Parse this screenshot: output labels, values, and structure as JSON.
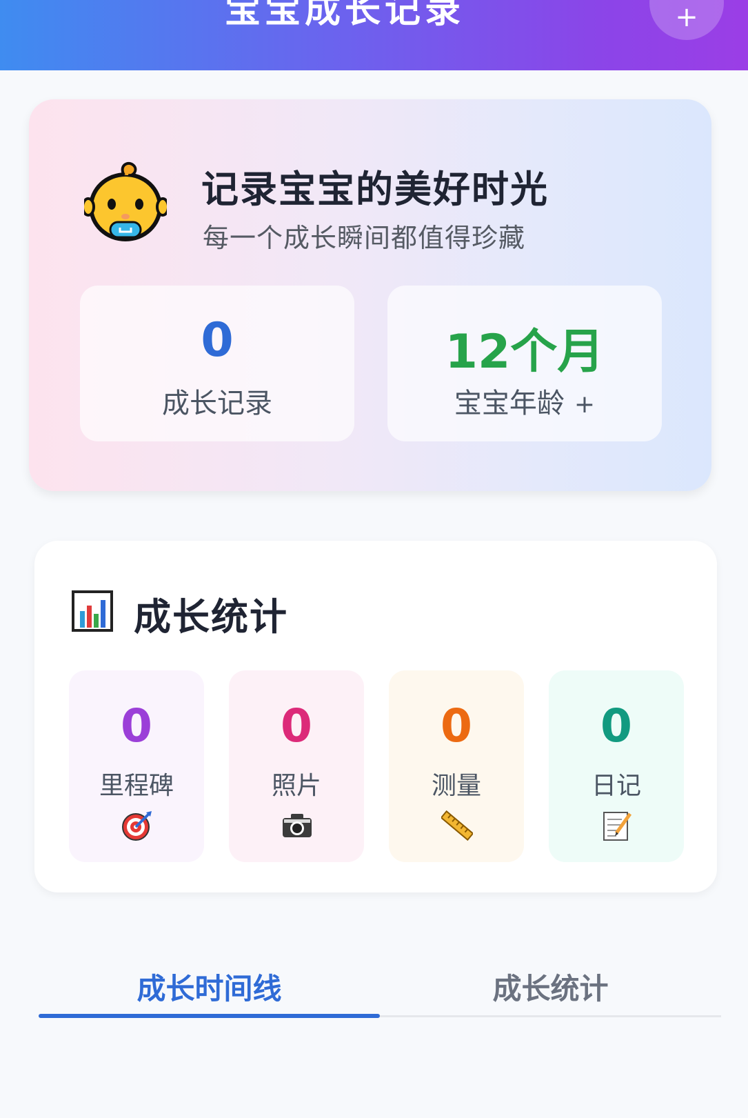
{
  "header": {
    "title": "宝宝成长记录",
    "add_label": "+"
  },
  "hero": {
    "title": "记录宝宝的美好时光",
    "subtitle": "每一个成长瞬间都值得珍藏",
    "icon": "baby-face-icon",
    "cards": [
      {
        "value": "0",
        "label": "成长记录",
        "color": "#2f6bd6"
      },
      {
        "value": "12个月",
        "label": "宝宝年龄",
        "action": "+",
        "color": "#27a34a"
      }
    ]
  },
  "stats": {
    "title": "成长统计",
    "icon": "bar-chart-icon",
    "items": [
      {
        "value": "0",
        "label": "里程碑",
        "icon": "target-icon",
        "color": "#9b3fd8"
      },
      {
        "value": "0",
        "label": "照片",
        "icon": "camera-icon",
        "color": "#dc2a79"
      },
      {
        "value": "0",
        "label": "测量",
        "icon": "ruler-icon",
        "color": "#ec6a12"
      },
      {
        "value": "0",
        "label": "日记",
        "icon": "memo-icon",
        "color": "#129a80"
      }
    ]
  },
  "tabs": [
    {
      "label": "成长时间线",
      "active": true
    },
    {
      "label": "成长统计",
      "active": false
    }
  ]
}
